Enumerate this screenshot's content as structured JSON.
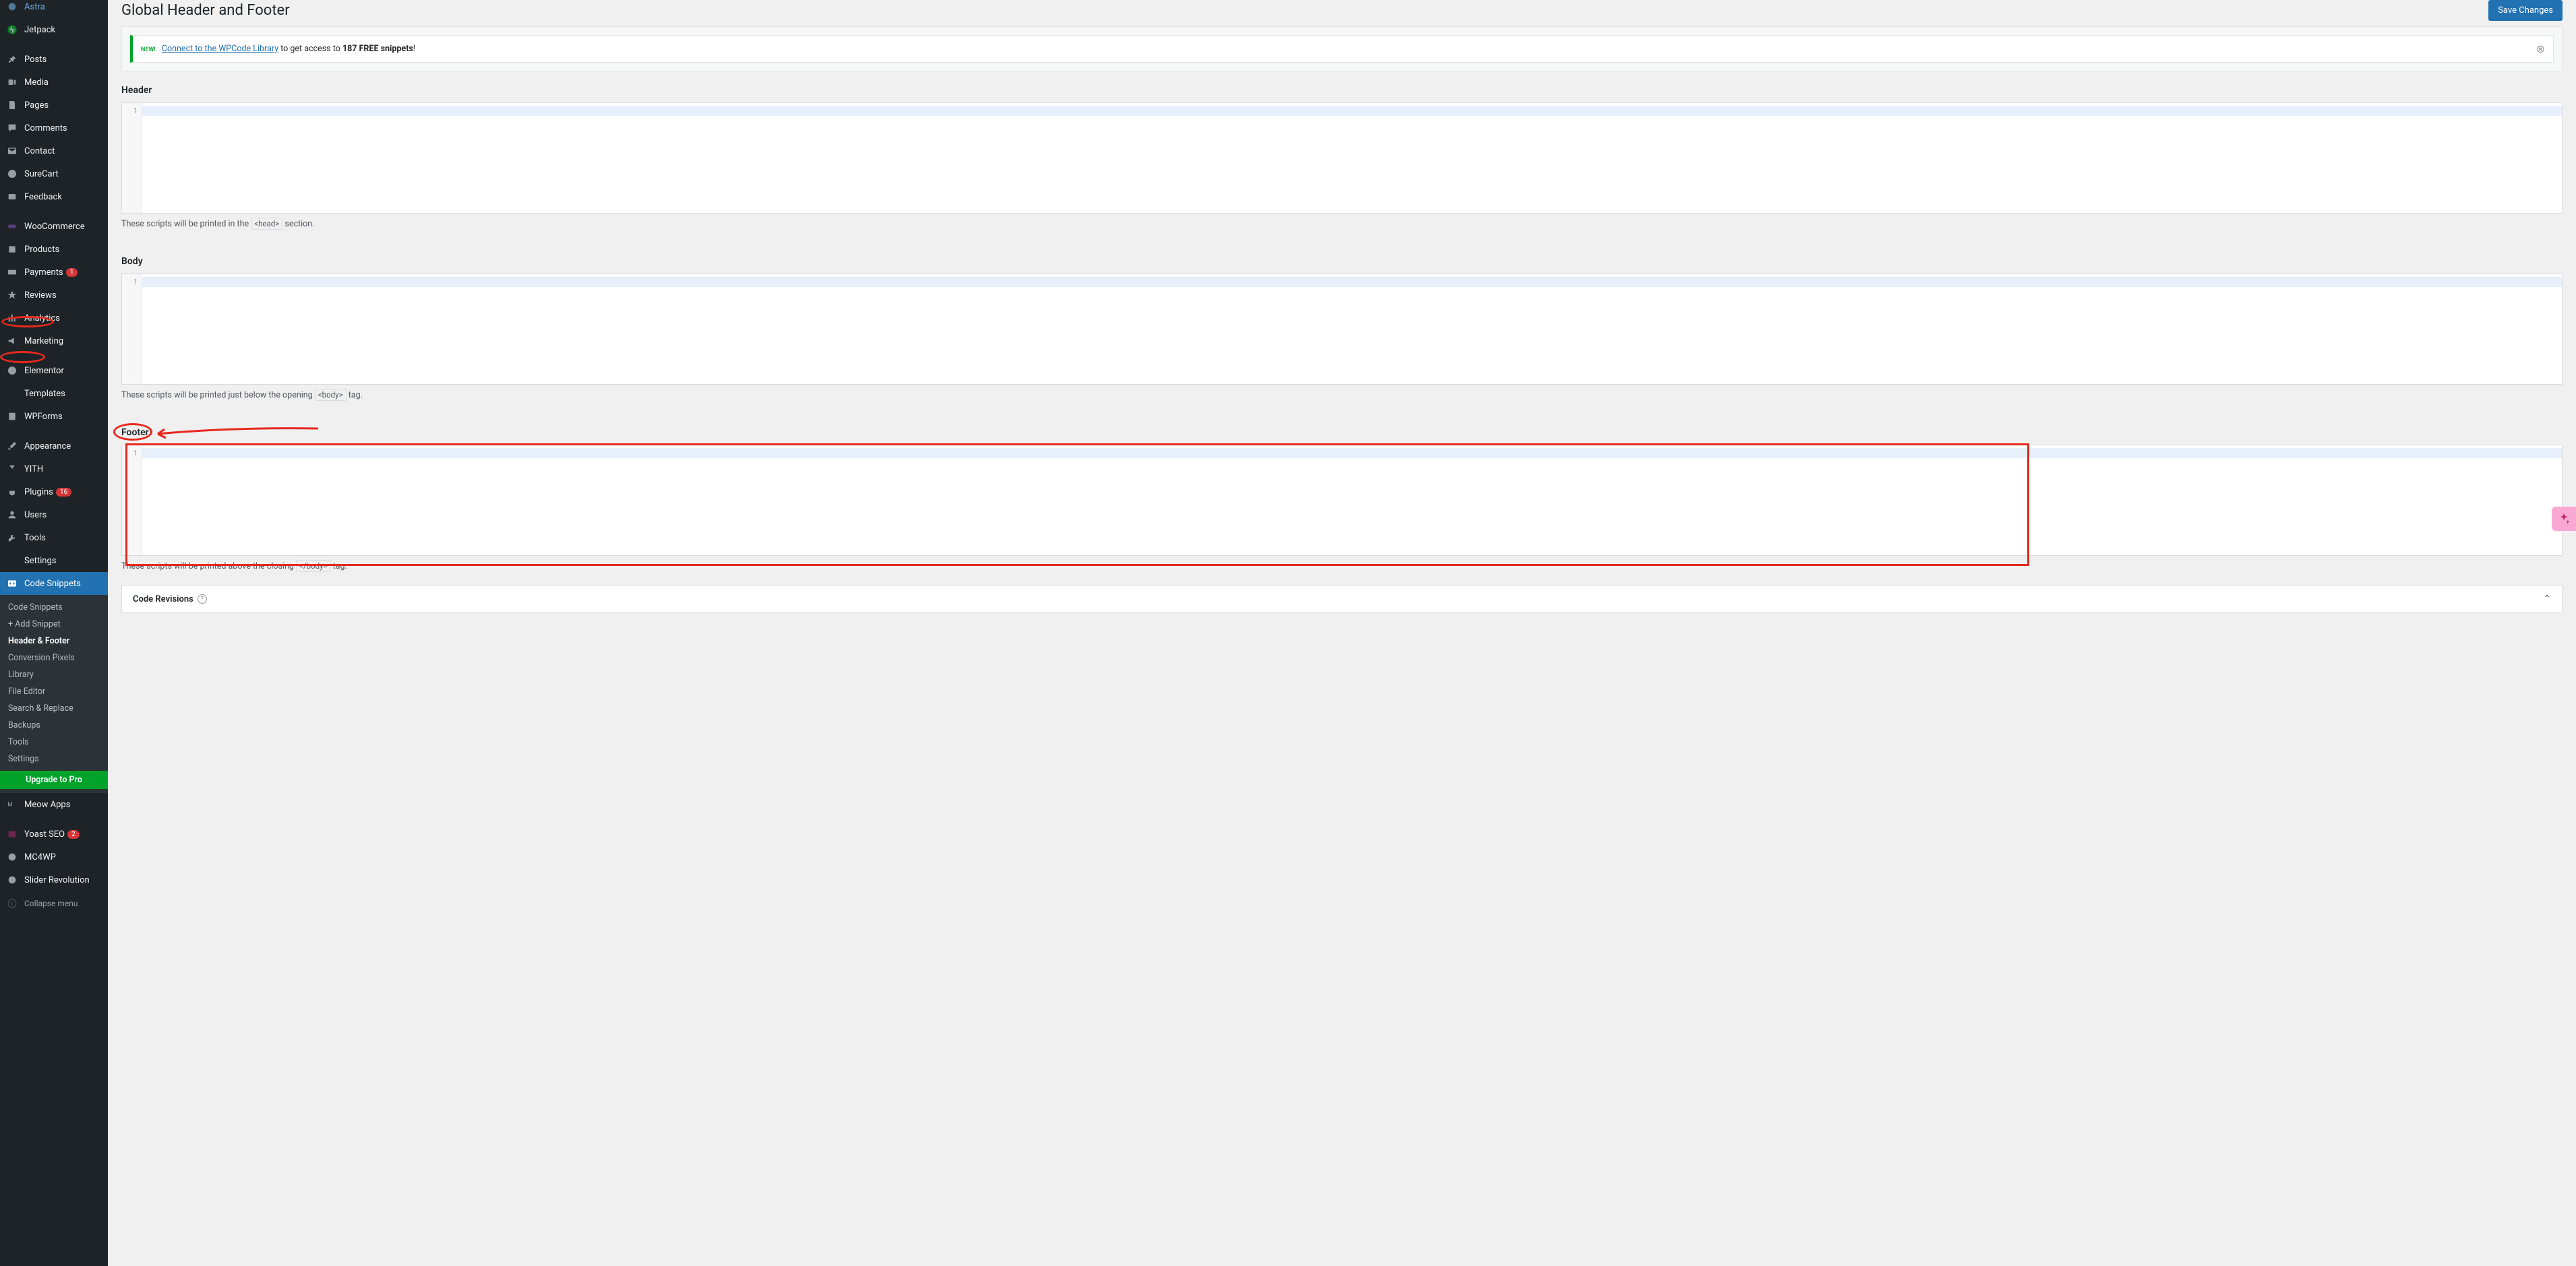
{
  "sidebar": {
    "items": [
      {
        "label": "Astra",
        "icon": "astra"
      },
      {
        "label": "Jetpack",
        "icon": "jetpack"
      },
      {
        "label": "Posts",
        "icon": "pin"
      },
      {
        "label": "Media",
        "icon": "media"
      },
      {
        "label": "Pages",
        "icon": "page"
      },
      {
        "label": "Comments",
        "icon": "comment"
      },
      {
        "label": "Contact",
        "icon": "mail"
      },
      {
        "label": "SureCart",
        "icon": "cart"
      },
      {
        "label": "Feedback",
        "icon": "feedback"
      },
      {
        "label": "WooCommerce",
        "icon": "woo"
      },
      {
        "label": "Products",
        "icon": "product"
      },
      {
        "label": "Payments",
        "icon": "payment",
        "badge": "1"
      },
      {
        "label": "Reviews",
        "icon": "star"
      },
      {
        "label": "Analytics",
        "icon": "analytics"
      },
      {
        "label": "Marketing",
        "icon": "marketing"
      },
      {
        "label": "Elementor",
        "icon": "elementor"
      },
      {
        "label": "Templates",
        "icon": "templates"
      },
      {
        "label": "WPForms",
        "icon": "wpforms"
      },
      {
        "label": "Appearance",
        "icon": "brush"
      },
      {
        "label": "YITH",
        "icon": "yith"
      },
      {
        "label": "Plugins",
        "icon": "plugin",
        "badge": "16"
      },
      {
        "label": "Users",
        "icon": "users"
      },
      {
        "label": "Tools",
        "icon": "tools"
      },
      {
        "label": "Settings",
        "icon": "settings"
      },
      {
        "label": "Code Snippets",
        "icon": "code",
        "active": true
      }
    ],
    "submenu": [
      {
        "label": "Code Snippets"
      },
      {
        "label": "+ Add Snippet"
      },
      {
        "label": "Header & Footer",
        "active": true
      },
      {
        "label": "Conversion Pixels"
      },
      {
        "label": "Library"
      },
      {
        "label": "File Editor"
      },
      {
        "label": "Search & Replace"
      },
      {
        "label": "Backups"
      },
      {
        "label": "Tools"
      },
      {
        "label": "Settings"
      },
      {
        "label": "Upgrade to Pro",
        "upgrade": true
      }
    ],
    "after_items": [
      {
        "label": "Meow Apps",
        "icon": "meow"
      },
      {
        "label": "Yoast SEO",
        "icon": "yoast",
        "badge": "2"
      },
      {
        "label": "MC4WP",
        "icon": "mc4wp"
      },
      {
        "label": "Slider Revolution",
        "icon": "slider"
      }
    ],
    "collapse_label": "Collapse menu"
  },
  "page": {
    "title": "Global Header and Footer",
    "save_button": "Save Changes"
  },
  "notice": {
    "new_label": "NEW!",
    "link_text": "Connect to the WPCode Library",
    "text_middle": " to get access to ",
    "bold_text": "187 FREE snippets",
    "text_end": "!"
  },
  "sections": {
    "header": {
      "title": "Header",
      "line": "1",
      "help_before": "These scripts will be printed in the ",
      "help_code": "<head>",
      "help_after": " section."
    },
    "body": {
      "title": "Body",
      "line": "1",
      "help_before": "These scripts will be printed just below the opening ",
      "help_code": "<body>",
      "help_after": " tag."
    },
    "footer": {
      "title": "Footer",
      "line": "1",
      "help_before": "These scripts will be printed above the closing ",
      "help_code": "</body>",
      "help_after": " tag."
    }
  },
  "accordion": {
    "title": "Code Revisions"
  }
}
